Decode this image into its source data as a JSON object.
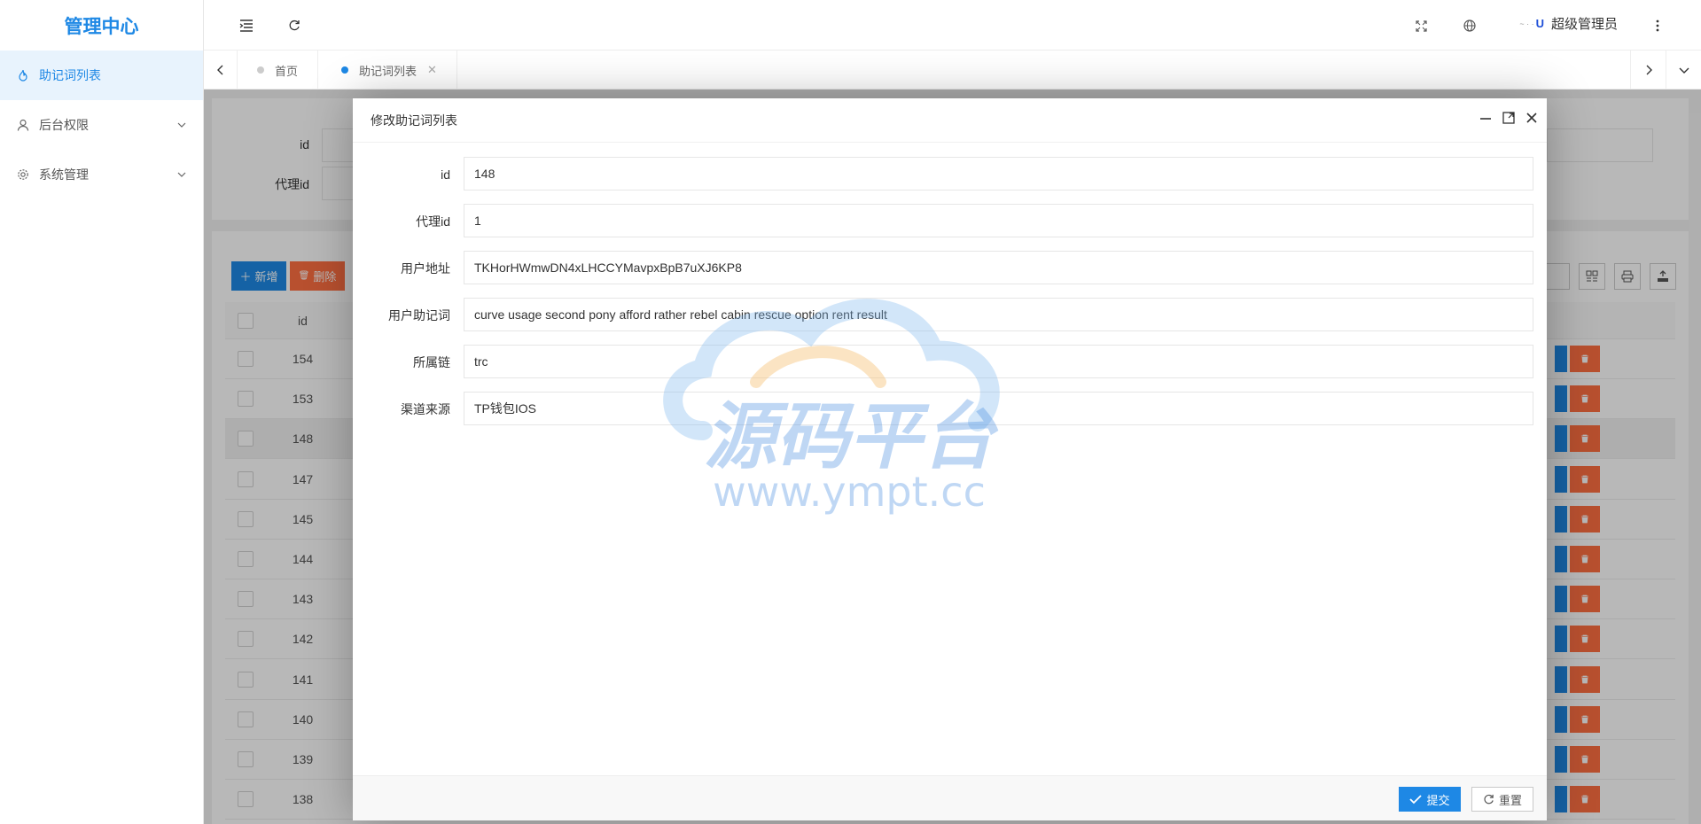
{
  "sidebar": {
    "logo": "管理中心",
    "items": [
      {
        "label": "助记词列表",
        "icon": "fire-icon",
        "active": true
      },
      {
        "label": "后台权限",
        "icon": "user-icon",
        "expandable": true
      },
      {
        "label": "系统管理",
        "icon": "gear-icon",
        "expandable": true
      }
    ]
  },
  "header": {
    "user_name": "超级管理员",
    "avatar_text": "U"
  },
  "tabs": [
    {
      "label": "首页",
      "active": false
    },
    {
      "label": "助记词列表",
      "active": true
    }
  ],
  "search": {
    "fields": [
      {
        "label": "id"
      },
      {
        "label": "代理id"
      }
    ]
  },
  "toolbar": {
    "add_label": "新增",
    "delete_label": "删除"
  },
  "table": {
    "columns": [
      "id"
    ],
    "rows": [
      "154",
      "153",
      "148",
      "147",
      "145",
      "144",
      "143",
      "142",
      "141",
      "140",
      "139",
      "138"
    ],
    "highlighted_id": "148"
  },
  "modal": {
    "title": "修改助记词列表",
    "fields": [
      {
        "label": "id",
        "value": "148"
      },
      {
        "label": "代理id",
        "value": "1"
      },
      {
        "label": "用户地址",
        "value": "TKHorHWmwDN4xLHCCYMavpxBpB7uXJ6KP8"
      },
      {
        "label": "用户助记词",
        "value": "curve usage second pony afford rather rebel cabin rescue option rent result"
      },
      {
        "label": "所属链",
        "value": "trc"
      },
      {
        "label": "渠道来源",
        "value": "TP钱包IOS"
      }
    ],
    "submit_label": "提交",
    "reset_label": "重置"
  },
  "watermark": {
    "text_cn": "源码平台",
    "text_url": "www.ympt.cc"
  },
  "colors": {
    "primary": "#1e88e5",
    "danger": "#ff5722",
    "active_menu_bg": "#e8f3fd"
  }
}
